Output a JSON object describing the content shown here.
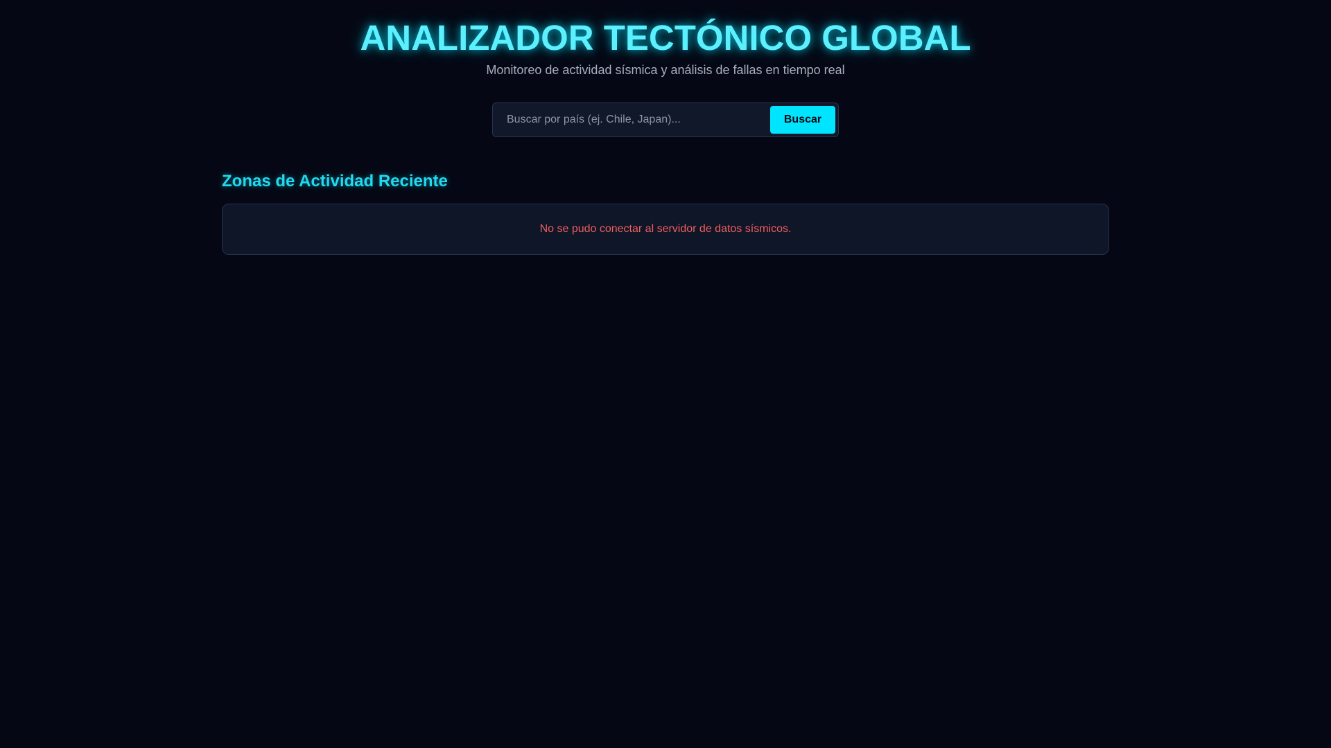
{
  "header": {
    "title": "ANALIZADOR TECTÓNICO GLOBAL",
    "subtitle": "Monitoreo de actividad sísmica y análisis de fallas en tiempo real"
  },
  "search": {
    "placeholder": "Buscar por país (ej. Chile, Japan)...",
    "value": "",
    "button_label": "Buscar"
  },
  "section": {
    "title": "Zonas de Actividad Reciente",
    "error_message": "No se pudo conectar al servidor de datos sísmicos."
  },
  "colors": {
    "background": "#050814",
    "accent": "#00e5ff",
    "error": "#ef5d5d",
    "panel": "#0f1628"
  }
}
